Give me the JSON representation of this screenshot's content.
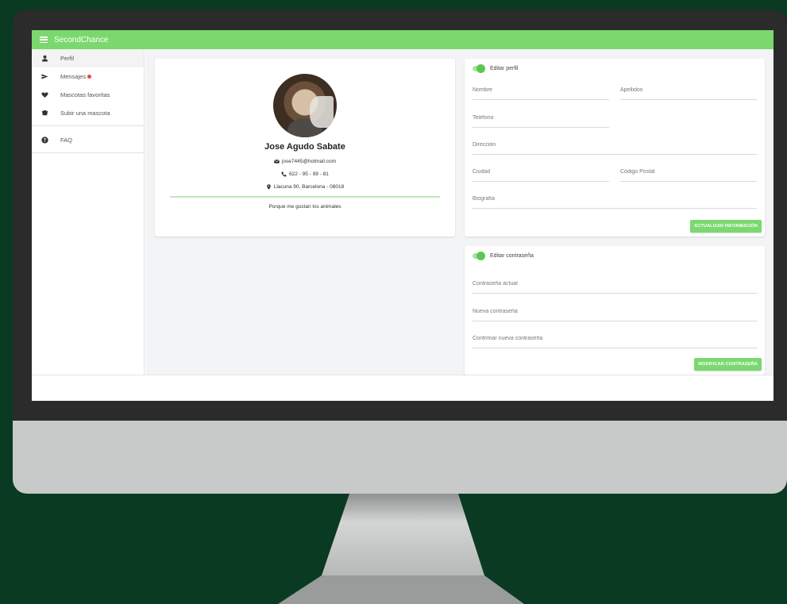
{
  "app": {
    "title": "SecondChance"
  },
  "sidebar": {
    "items": [
      {
        "label": "Perfil",
        "icon": "person-icon",
        "active": true
      },
      {
        "label": "Mensajes",
        "icon": "send-icon",
        "has_badge": true
      },
      {
        "label": "Mascotas favoritas",
        "icon": "heart-icon"
      },
      {
        "label": "Subir una mascota",
        "icon": "paw-icon"
      },
      {
        "label": "FAQ",
        "icon": "help-icon"
      }
    ]
  },
  "profile": {
    "name": "Jose Agudo Sabate",
    "email": "jose7445@hotmail.com",
    "phone": "622 - 95 - 99 - 81",
    "address": "Llacuna 90, Barcelona - 08018",
    "bio": "Porque me gustan los animales"
  },
  "edit_profile": {
    "toggle_label": "Editar perfil",
    "fields": {
      "nombre": "Nombre",
      "apellidos": "Apellidos",
      "telefono": "Teléfono",
      "direccion": "Dirección",
      "ciudad": "Ciudad",
      "codigo_postal": "Código Postal",
      "biografia": "Biografía"
    },
    "button": "ACTUALIZAR INFORMACIÓN"
  },
  "edit_password": {
    "toggle_label": "Editar contraseña",
    "fields": {
      "actual": "Contraseña actual",
      "nueva": "Nueva contraseña",
      "confirmar": "Confirmar nueva contraseña"
    },
    "button": "MODIFICAR CONTRASEÑA"
  },
  "colors": {
    "accent": "#7bd86f",
    "background": "#0a3a21",
    "badge": "#e54848"
  }
}
